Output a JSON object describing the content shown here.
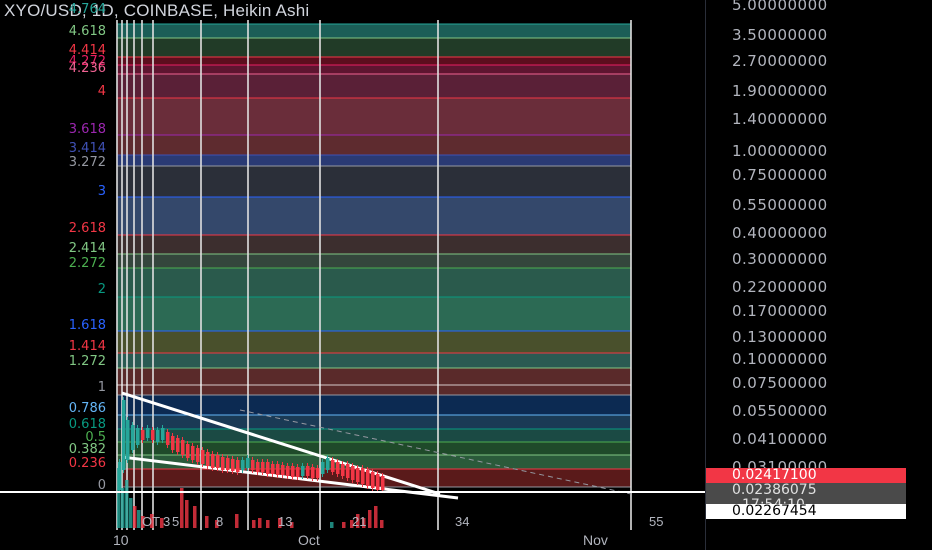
{
  "header": {
    "title": "XYO/USD, 1D, COINBASE, Heikin Ashi"
  },
  "price_scale": {
    "labels": [
      "5.00000000",
      "3.50000000",
      "2.70000000",
      "1.90000000",
      "1.40000000",
      "1.00000000",
      "0.75000000",
      "0.55000000",
      "0.40000000",
      "0.30000000",
      "0.22000000",
      "0.17000000",
      "0.13000000",
      "0.10000000",
      "0.07500000",
      "0.05500000",
      "0.04100000",
      "0.03100000"
    ],
    "last_price": "0.02417100",
    "second_price": "0.02386075",
    "countdown": "17:54:10",
    "crosshair_price": "0.02267454",
    "colors": {
      "last_bg": "#f23645",
      "secondary_bg": "#4a4a4a",
      "crosshair_bg": "#ffffff"
    }
  },
  "fib_levels": [
    {
      "label": "4.764",
      "color": "#26a69a"
    },
    {
      "label": "4.618",
      "color": "#81c784"
    },
    {
      "label": "4.414",
      "color": "#f23645"
    },
    {
      "label": "4.272",
      "color": "#e91e63"
    },
    {
      "label": "4.236",
      "color": "#f06292"
    },
    {
      "label": "4",
      "color": "#f23645"
    },
    {
      "label": "3.618",
      "color": "#9c27b0"
    },
    {
      "label": "3.414",
      "color": "#3f51b5"
    },
    {
      "label": "3.272",
      "color": "#9598a1"
    },
    {
      "label": "3",
      "color": "#2962ff"
    },
    {
      "label": "2.618",
      "color": "#f23645"
    },
    {
      "label": "2.414",
      "color": "#81c784"
    },
    {
      "label": "2.272",
      "color": "#4caf50"
    },
    {
      "label": "2",
      "color": "#089981"
    },
    {
      "label": "1.618",
      "color": "#2962ff"
    },
    {
      "label": "1.414",
      "color": "#f23645"
    },
    {
      "label": "1.272",
      "color": "#81c784"
    },
    {
      "label": "1",
      "color": "#9598a1"
    },
    {
      "label": "0.786",
      "color": "#64b5f6"
    },
    {
      "label": "0.618",
      "color": "#089981"
    },
    {
      "label": "0.5",
      "color": "#4caf50"
    },
    {
      "label": "0.382",
      "color": "#81c784"
    },
    {
      "label": "0.236",
      "color": "#f23645"
    },
    {
      "label": "0",
      "color": "#9598a1"
    }
  ],
  "time_axis": {
    "labels": [
      "10",
      "Oct",
      "Nov"
    ]
  },
  "bar_labels": [
    "OT",
    "3",
    "5",
    "8",
    "13",
    "21",
    "34",
    "55"
  ]
}
